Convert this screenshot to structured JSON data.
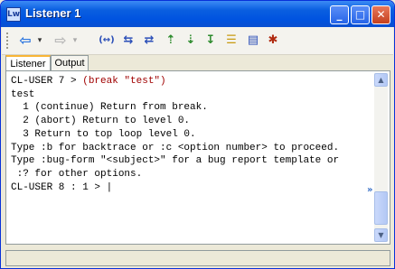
{
  "window": {
    "title": "Listener 1",
    "icon_letter": "Lw"
  },
  "titlebar_buttons": {
    "minimize": "_",
    "maximize": "□",
    "close": "✕"
  },
  "toolbar": {
    "back": "⇦",
    "back_drop": "▾",
    "forward": "⇨",
    "forward_drop": "▾",
    "tools": [
      "(↔)",
      "⇆",
      "⇄",
      "⇡",
      "⇣",
      "↧",
      "☰",
      "▤",
      "✱"
    ]
  },
  "tabs": [
    {
      "label": "Listener"
    },
    {
      "label": "Output"
    }
  ],
  "listener": {
    "line1_prompt": "CL-USER 7 > ",
    "line1_form": "(break \"test\")",
    "lines": [
      "",
      "test",
      "  1 (continue) Return from break.",
      "  2 (abort) Return to level 0.",
      "  3 Return to top loop level 0.",
      "",
      "Type :b for backtrace or :c <option number> to proceed.",
      "Type :bug-form \"<subject>\" for a bug report template or",
      " :? for other options.",
      "",
      "CL-USER 8 : 1 > |"
    ],
    "more_indicator": "»"
  },
  "scrollbar": {
    "up": "▲",
    "down": "▼"
  },
  "colors": {
    "title_blue": "#0053e0",
    "prompt_red": "#a00000",
    "toolbar_blue": "#2b4fb8"
  }
}
